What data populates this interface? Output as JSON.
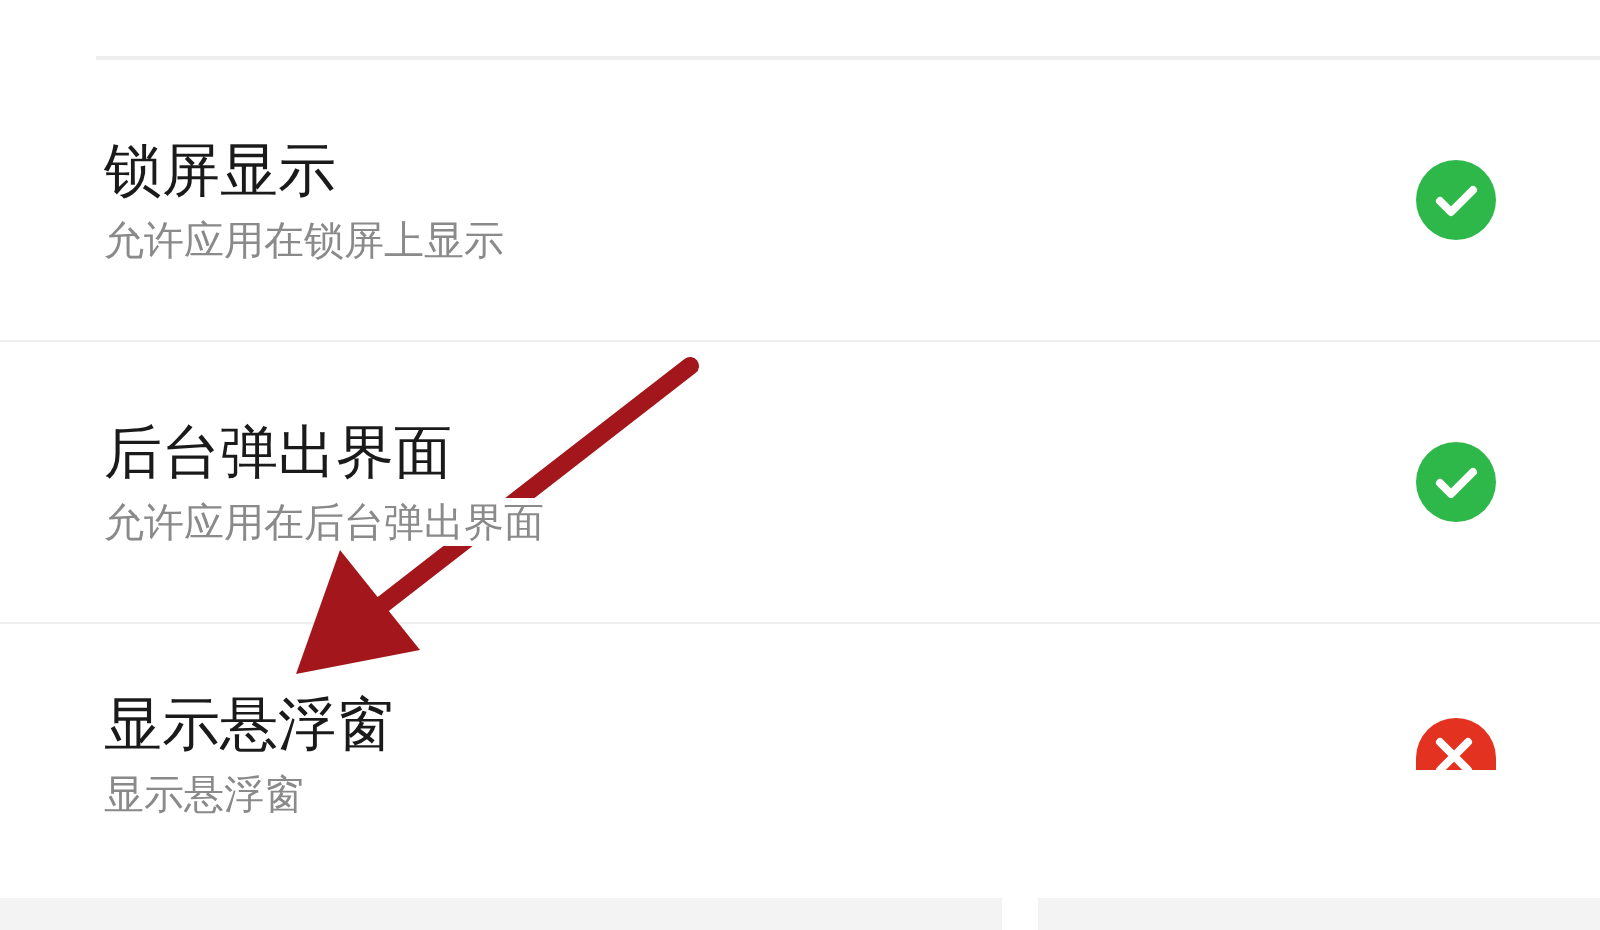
{
  "permissions": [
    {
      "title": "锁屏显示",
      "description": "允许应用在锁屏上显示",
      "allowed": true
    },
    {
      "title": "后台弹出界面",
      "description": "允许应用在后台弹出界面",
      "allowed": true
    },
    {
      "title": "显示悬浮窗",
      "description": "显示悬浮窗",
      "allowed": false
    }
  ]
}
